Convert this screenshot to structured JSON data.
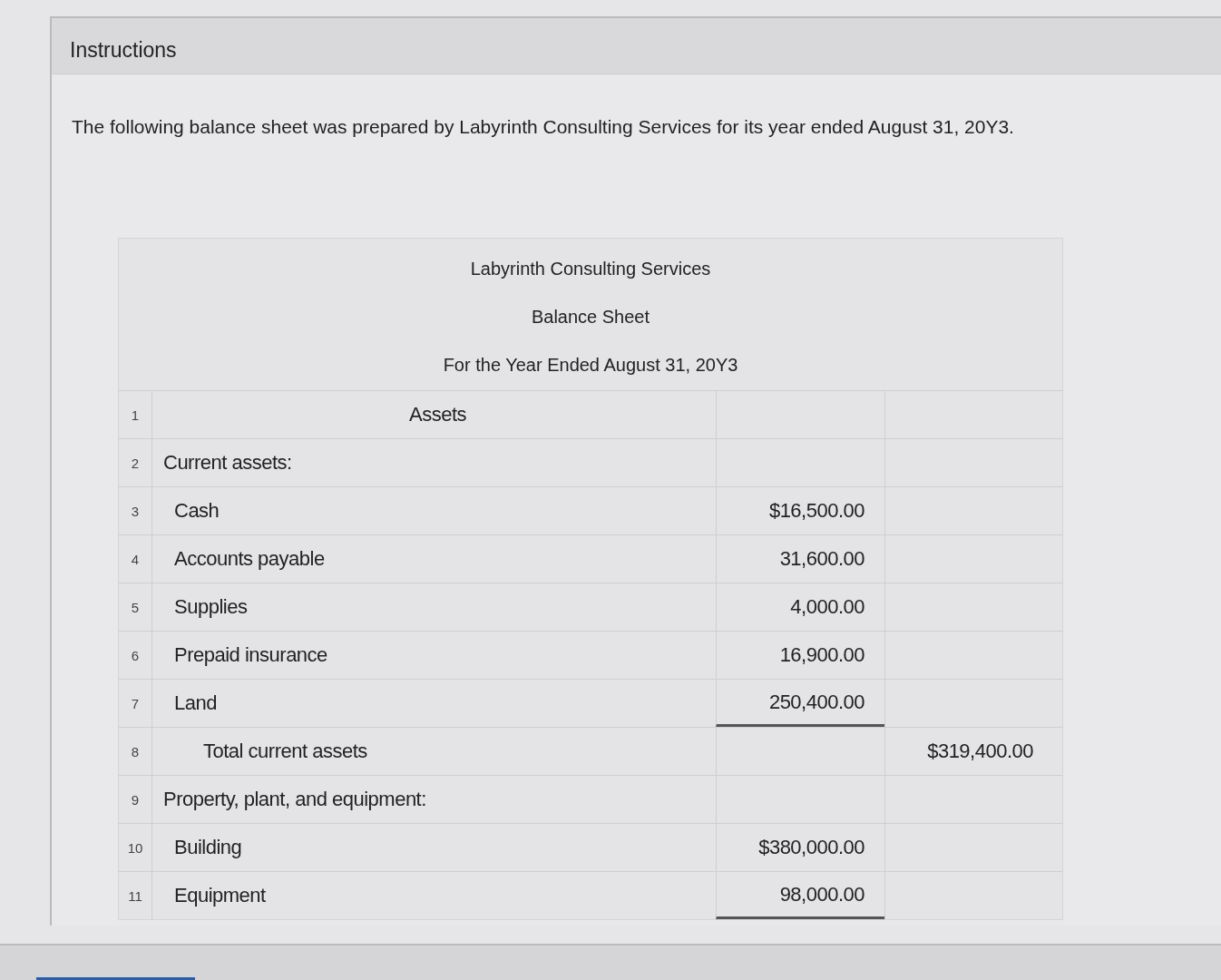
{
  "instructions": {
    "title": "Instructions",
    "text": "The following balance sheet was prepared by Labyrinth Consulting Services for its year ended August 31, 20Y3."
  },
  "balance_sheet": {
    "heading": [
      "Labyrinth Consulting Services",
      "Balance Sheet",
      "For the Year Ended August 31, 20Y3"
    ],
    "rows": [
      {
        "number": "1",
        "kind": "section",
        "label": "Assets",
        "amount": "",
        "total": "",
        "underlined": false
      },
      {
        "number": "2",
        "kind": "heading",
        "label": "Current assets:",
        "amount": "",
        "total": "",
        "underlined": false
      },
      {
        "number": "3",
        "kind": "item",
        "label": "Cash",
        "amount": "$16,500.00",
        "total": "",
        "underlined": false
      },
      {
        "number": "4",
        "kind": "item",
        "label": "Accounts payable",
        "amount": "31,600.00",
        "total": "",
        "underlined": false
      },
      {
        "number": "5",
        "kind": "item",
        "label": "Supplies",
        "amount": "4,000.00",
        "total": "",
        "underlined": false
      },
      {
        "number": "6",
        "kind": "item",
        "label": "Prepaid insurance",
        "amount": "16,900.00",
        "total": "",
        "underlined": false
      },
      {
        "number": "7",
        "kind": "item",
        "label": "Land",
        "amount": "250,400.00",
        "total": "",
        "underlined": true
      },
      {
        "number": "8",
        "kind": "total",
        "label": "Total current assets",
        "amount": "",
        "total": "$319,400.00",
        "underlined": false
      },
      {
        "number": "9",
        "kind": "heading",
        "label": "Property, plant, and equipment:",
        "amount": "",
        "total": "",
        "underlined": false
      },
      {
        "number": "10",
        "kind": "item",
        "label": "Building",
        "amount": "$380,000.00",
        "total": "",
        "underlined": false
      },
      {
        "number": "11",
        "kind": "item",
        "label": "Equipment",
        "amount": "98,000.00",
        "total": "",
        "underlined": true
      }
    ]
  }
}
